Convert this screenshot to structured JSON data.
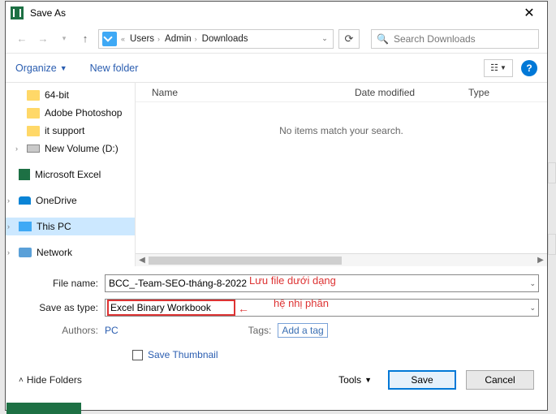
{
  "title": "Save As",
  "breadcrumb": [
    "Users",
    "Admin",
    "Downloads"
  ],
  "search_placeholder": "Search Downloads",
  "toolbar": {
    "organize": "Organize",
    "newfolder": "New folder"
  },
  "tree": {
    "items": [
      {
        "label": "64-bit",
        "icon": "folder"
      },
      {
        "label": "Adobe Photoshop",
        "icon": "folder"
      },
      {
        "label": "it support",
        "icon": "folder"
      },
      {
        "label": "New Volume (D:)",
        "icon": "drive"
      },
      {
        "label": "Microsoft Excel",
        "icon": "excel"
      },
      {
        "label": "OneDrive",
        "icon": "onedrive"
      },
      {
        "label": "This PC",
        "icon": "pc",
        "selected": true
      },
      {
        "label": "Network",
        "icon": "network"
      }
    ]
  },
  "columns": {
    "name": "Name",
    "date": "Date modified",
    "type": "Type"
  },
  "empty_msg": "No items match your search.",
  "file_name_label": "File name:",
  "file_name_value": "BCC_-Team-SEO-tháng-8-2022",
  "save_type_label": "Save as type:",
  "save_type_value": "Excel Binary Workbook",
  "authors_label": "Authors:",
  "authors_value": "PC",
  "tags_label": "Tags:",
  "tags_value": "Add a tag",
  "save_thumb": "Save Thumbnail",
  "hide_folders": "Hide Folders",
  "tools": "Tools",
  "save": "Save",
  "cancel": "Cancel",
  "annot1": "Lưu file dưới dạng",
  "annot2": "hệ nhị phân"
}
